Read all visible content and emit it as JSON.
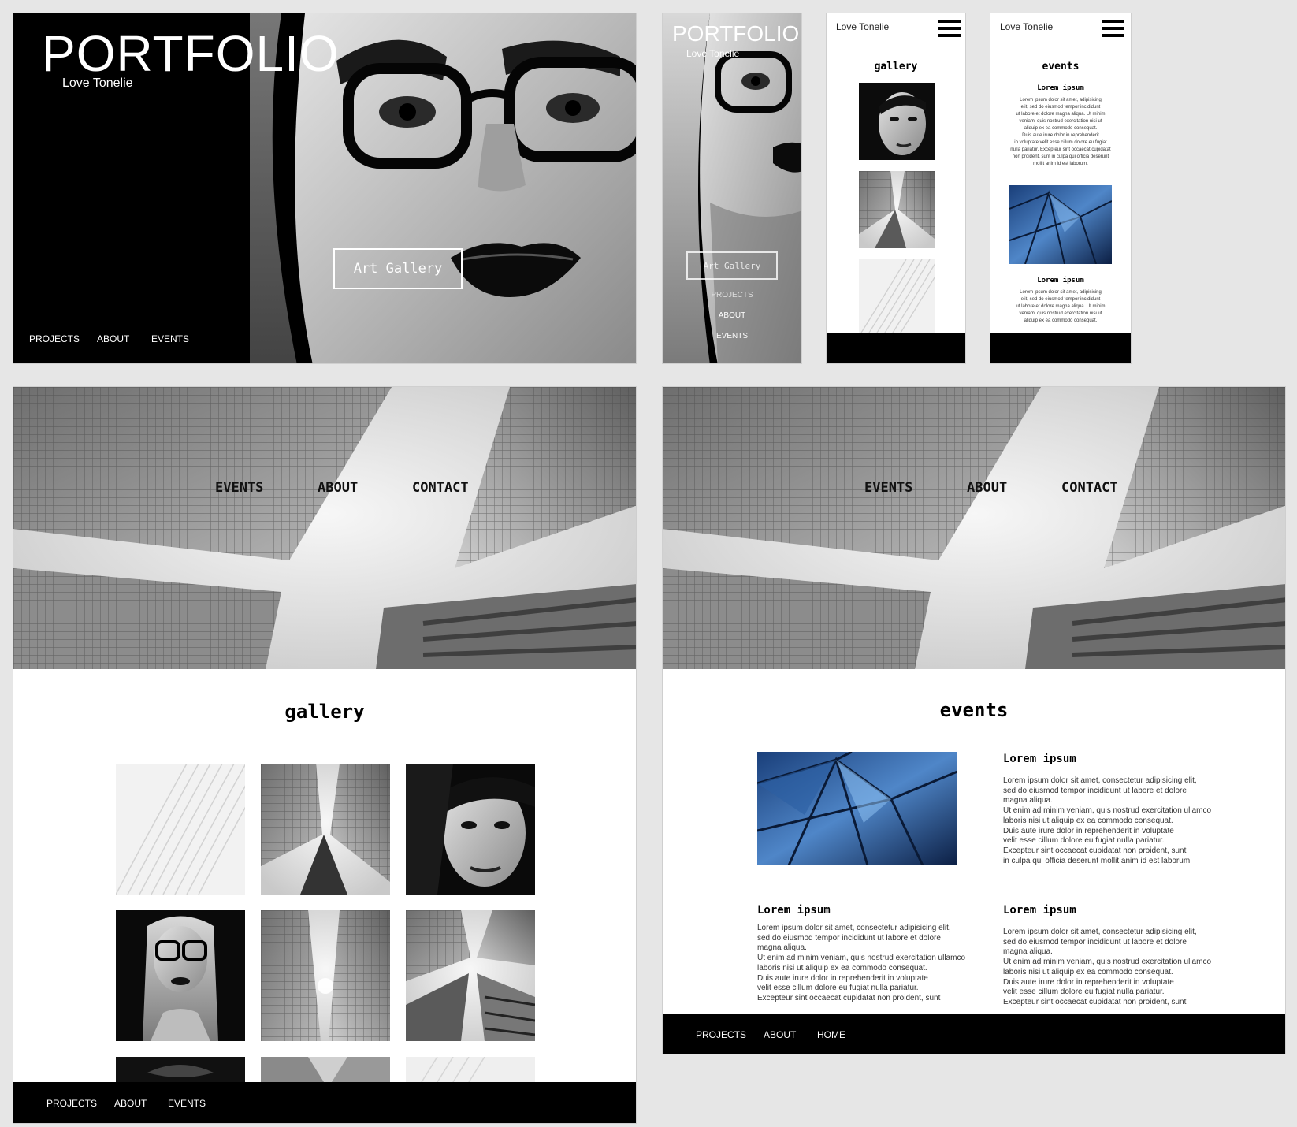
{
  "desktop_home": {
    "title": "PORTFOLIO",
    "subtitle": "Love Tonelie",
    "cta": "Art Gallery",
    "nav": [
      "PROJECTS",
      "ABOUT",
      "EVENTS"
    ]
  },
  "mobile_home": {
    "title": "PORTFOLIO",
    "subtitle": "Love Tonelie",
    "cta": "Art Gallery",
    "menu": [
      "PROJECTS",
      "ABOUT",
      "EVENTS"
    ]
  },
  "mobile_gallery": {
    "brand": "Love Tonelie",
    "heading": "gallery"
  },
  "mobile_events": {
    "brand": "Love Tonelie",
    "heading": "events",
    "item1_title": "Lorem ipsum",
    "item1_body": "Lorem ipsum dolor sit amet, adipisicing\nelit, sed do eiusmod tempor incididunt\nut labore et dolore magna aliqua. Ut minim\nveniam, quis nostrud exercitation nisi ut\naliquip ex ea commodo consequat.\nDuis aute irure dolor in reprehenderit\nin voluptate velit esse cillum dolore eu fugiat\nnulla pariatur. Excepteur sint occaecat cupidatat\nnon proident, sunt in culpa qui officia deserunt\nmollit anim id est laborum.",
    "item2_title": "Lorem ipsum",
    "item2_body": "Lorem ipsum dolor sit amet, adipisicing\nelit, sed do eiusmod tempor incididunt\nut labore et dolore magna aliqua. Ut minim\nveniam, quis nostrud exercitation nisi ut\naliquip ex ea commodo consequat."
  },
  "desktop_gallery": {
    "nav": [
      "EVENTS",
      "ABOUT",
      "CONTACT"
    ],
    "heading": "gallery",
    "footer_nav": [
      "PROJECTS",
      "ABOUT",
      "EVENTS"
    ]
  },
  "desktop_events": {
    "nav": [
      "EVENTS",
      "ABOUT",
      "CONTACT"
    ],
    "heading": "events",
    "feature_title": "Lorem ipsum",
    "feature_body": "Lorem ipsum dolor sit amet, consectetur adipisicing elit,\nsed do eiusmod tempor incididunt ut labore et dolore\nmagna aliqua.\nUt enim ad minim veniam, quis nostrud exercitation ullamco\nlaboris nisi ut aliquip ex ea commodo consequat.\nDuis aute irure dolor in reprehenderit in voluptate\nvelit esse cillum dolore eu fugiat nulla pariatur.\nExcepteur sint occaecat cupidatat non proident, sunt\nin culpa qui officia deserunt mollit anim id est laborum",
    "col1_title": "Lorem ipsum",
    "col1_body": "Lorem ipsum dolor sit amet, consectetur adipisicing elit,\nsed do eiusmod tempor incididunt ut labore et dolore\nmagna aliqua.\nUt enim ad minim veniam, quis nostrud exercitation ullamco\nlaboris nisi ut aliquip ex ea commodo consequat.\nDuis aute irure dolor in reprehenderit in voluptate\nvelit esse cillum dolore eu fugiat nulla pariatur.\nExcepteur sint occaecat cupidatat non proident, sunt",
    "col2_title": "Lorem ipsum",
    "col2_body": "Lorem ipsum dolor sit amet, consectetur adipisicing elit,\nsed do eiusmod tempor incididunt ut labore et dolore\nmagna aliqua.\nUt enim ad minim veniam, quis nostrud exercitation ullamco\nlaboris nisi ut aliquip ex ea commodo consequat.\nDuis aute irure dolor in reprehenderit in voluptate\nvelit esse cillum dolore eu fugiat nulla pariatur.\nExcepteur sint occaecat cupidatat non proident, sunt",
    "footer_nav": [
      "PROJECTS",
      "ABOUT",
      "HOME"
    ]
  }
}
